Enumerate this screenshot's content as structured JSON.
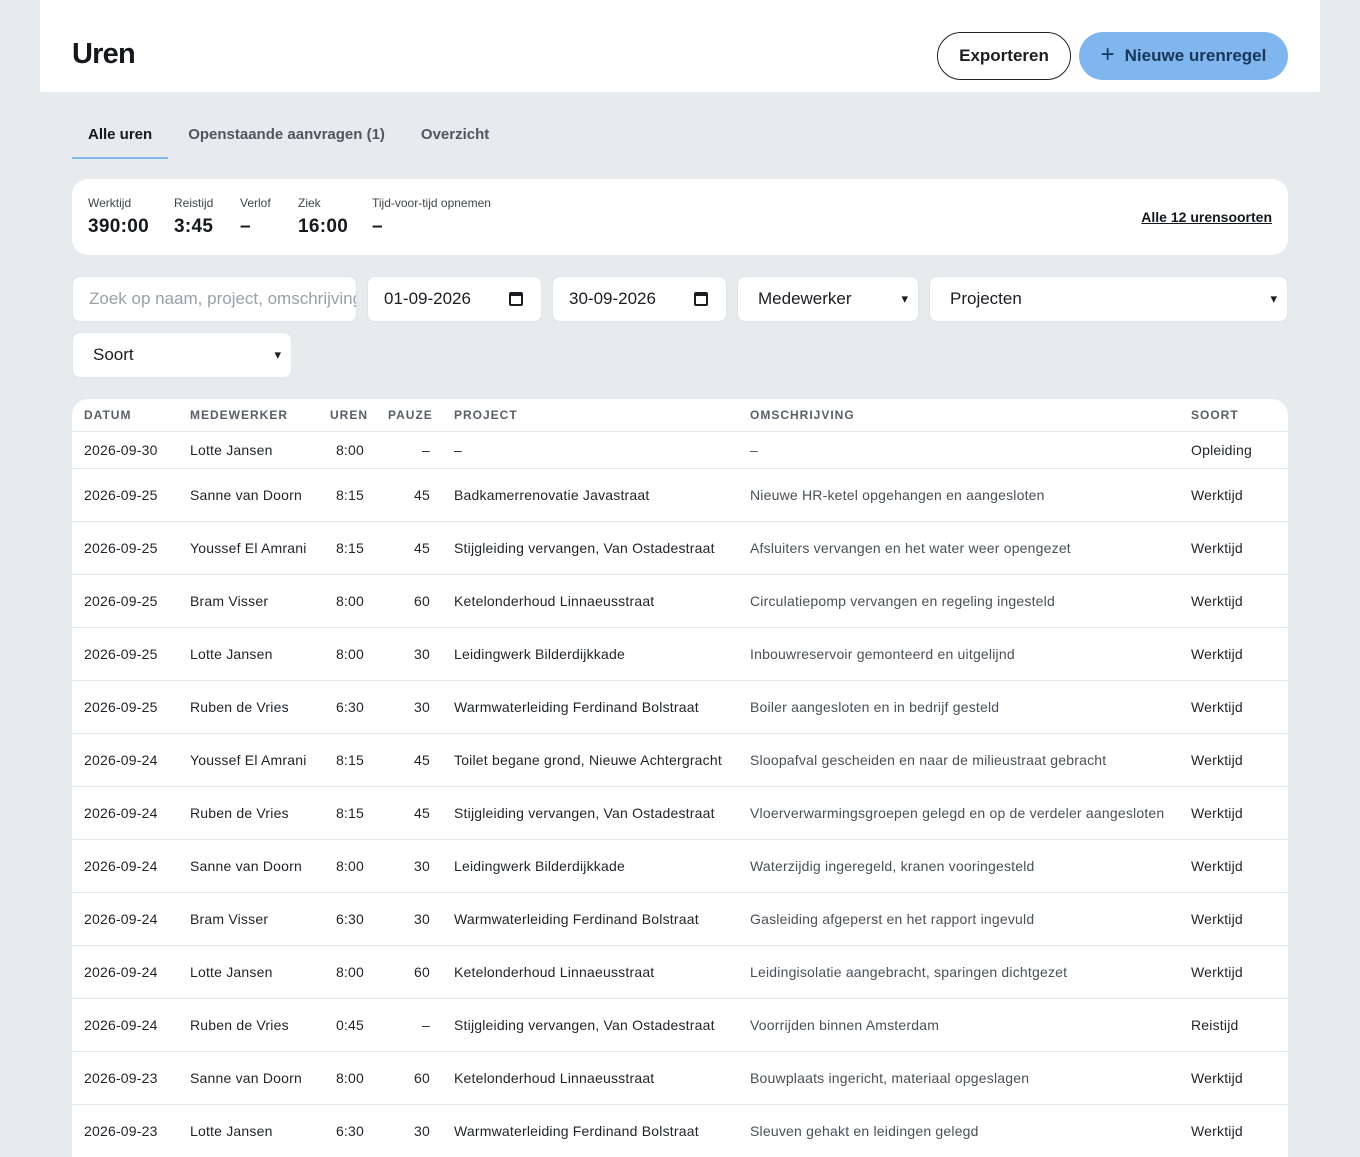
{
  "header": {
    "title": "Uren",
    "export_label": "Exporteren",
    "new_label": "Nieuwe urenregel",
    "new_icon": "plus-icon"
  },
  "tabs": [
    {
      "label": "Alle uren",
      "active": true
    },
    {
      "label": "Openstaande aanvragen (1)",
      "active": false
    },
    {
      "label": "Overzicht",
      "active": false
    }
  ],
  "summary": {
    "stats": [
      {
        "label": "Werktijd",
        "value": "390:00"
      },
      {
        "label": "Reistijd",
        "value": "3:45"
      },
      {
        "label": "Verlof",
        "value": "–"
      },
      {
        "label": "Ziek",
        "value": "16:00"
      },
      {
        "label": "Tijd-voor-tijd opnemen",
        "value": "–"
      }
    ],
    "link_label": "Alle 12 urensoorten"
  },
  "filters": {
    "search_placeholder": "Zoek op naam, project, omschrijving",
    "date_from": "01-09-2026",
    "date_to": "30-09-2026",
    "employee": "Medewerker",
    "projects": "Projecten",
    "type": "Soort"
  },
  "table": {
    "columns": [
      "DATUM",
      "MEDEWERKER",
      "UREN",
      "PAUZE",
      "PROJECT",
      "OMSCHRIJVING",
      "SOORT"
    ],
    "rows": [
      [
        "2026-09-30",
        "Lotte Jansen",
        "8:00",
        "–",
        "–",
        "–",
        "Opleiding"
      ],
      [
        "2026-09-25",
        "Sanne van Doorn",
        "8:15",
        "45",
        "Badkamerrenovatie Javastraat",
        "Nieuwe HR-ketel opgehangen en aangesloten",
        "Werktijd"
      ],
      [
        "2026-09-25",
        "Youssef El Amrani",
        "8:15",
        "45",
        "Stijgleiding vervangen, Van Ostadestraat",
        "Afsluiters vervangen en het water weer opengezet",
        "Werktijd"
      ],
      [
        "2026-09-25",
        "Bram Visser",
        "8:00",
        "60",
        "Ketelonderhoud Linnaeusstraat",
        "Circulatiepomp vervangen en regeling ingesteld",
        "Werktijd"
      ],
      [
        "2026-09-25",
        "Lotte Jansen",
        "8:00",
        "30",
        "Leidingwerk Bilderdijkkade",
        "Inbouwreservoir gemonteerd en uitgelijnd",
        "Werktijd"
      ],
      [
        "2026-09-25",
        "Ruben de Vries",
        "6:30",
        "30",
        "Warmwaterleiding Ferdinand Bolstraat",
        "Boiler aangesloten en in bedrijf gesteld",
        "Werktijd"
      ],
      [
        "2026-09-24",
        "Youssef El Amrani",
        "8:15",
        "45",
        "Toilet begane grond, Nieuwe Achtergracht",
        "Sloopafval gescheiden en naar de milieustraat gebracht",
        "Werktijd"
      ],
      [
        "2026-09-24",
        "Ruben de Vries",
        "8:15",
        "45",
        "Stijgleiding vervangen, Van Ostadestraat",
        "Vloerverwarmingsgroepen gelegd en op de verdeler aangesloten",
        "Werktijd"
      ],
      [
        "2026-09-24",
        "Sanne van Doorn",
        "8:00",
        "30",
        "Leidingwerk Bilderdijkkade",
        "Waterzijdig ingeregeld, kranen vooringesteld",
        "Werktijd"
      ],
      [
        "2026-09-24",
        "Bram Visser",
        "6:30",
        "30",
        "Warmwaterleiding Ferdinand Bolstraat",
        "Gasleiding afgeperst en het rapport ingevuld",
        "Werktijd"
      ],
      [
        "2026-09-24",
        "Lotte Jansen",
        "8:00",
        "60",
        "Ketelonderhoud Linnaeusstraat",
        "Leidingisolatie aangebracht, sparingen dichtgezet",
        "Werktijd"
      ],
      [
        "2026-09-24",
        "Ruben de Vries",
        "0:45",
        "–",
        "Stijgleiding vervangen, Van Ostadestraat",
        "Voorrijden binnen Amsterdam",
        "Reistijd"
      ],
      [
        "2026-09-23",
        "Sanne van Doorn",
        "8:00",
        "60",
        "Ketelonderhoud Linnaeusstraat",
        "Bouwplaats ingericht, materiaal opgeslagen",
        "Werktijd"
      ],
      [
        "2026-09-23",
        "Lotte Jansen",
        "6:30",
        "30",
        "Warmwaterleiding Ferdinand Bolstraat",
        "Sleuven gehakt en leidingen gelegd",
        "Werktijd"
      ]
    ]
  }
}
